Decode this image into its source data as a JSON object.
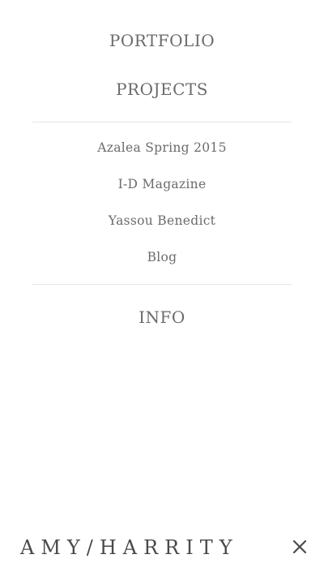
{
  "nav": {
    "portfolio": "PORTFOLIO",
    "projects": "PROJECTS",
    "project_items": [
      "Azalea Spring 2015",
      "I-D Magazine",
      "Yassou Benedict",
      "Blog"
    ],
    "info": "INFO"
  },
  "footer": {
    "logo": "AMY/HARRITY",
    "close_icon": "close-icon"
  },
  "colors": {
    "text": "#6b6b6b",
    "logo": "#4a4a4a",
    "divider": "#e6e6e6",
    "background": "#ffffff"
  }
}
